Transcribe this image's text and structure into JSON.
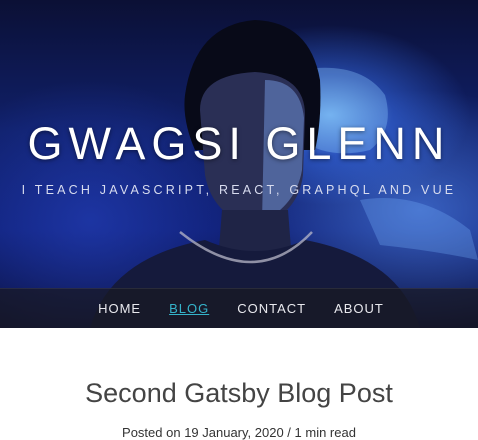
{
  "header": {
    "site_title": "GWAGSI GLENN",
    "tagline": "I TEACH JAVASCRIPT, REACT, GRAPHQL AND VUE"
  },
  "nav": {
    "items": [
      {
        "label": "HOME",
        "active": false
      },
      {
        "label": "BLOG",
        "active": true
      },
      {
        "label": "CONTACT",
        "active": false
      },
      {
        "label": "ABOUT",
        "active": false
      }
    ]
  },
  "post": {
    "title": "Second Gatsby Blog Post",
    "meta": "Posted on 19 January, 2020 / 1 min read"
  },
  "colors": {
    "hero_bg": "#10206a",
    "nav_active": "#35b3ca",
    "nav_text": "#e9e9ee",
    "title_text": "#444444"
  }
}
